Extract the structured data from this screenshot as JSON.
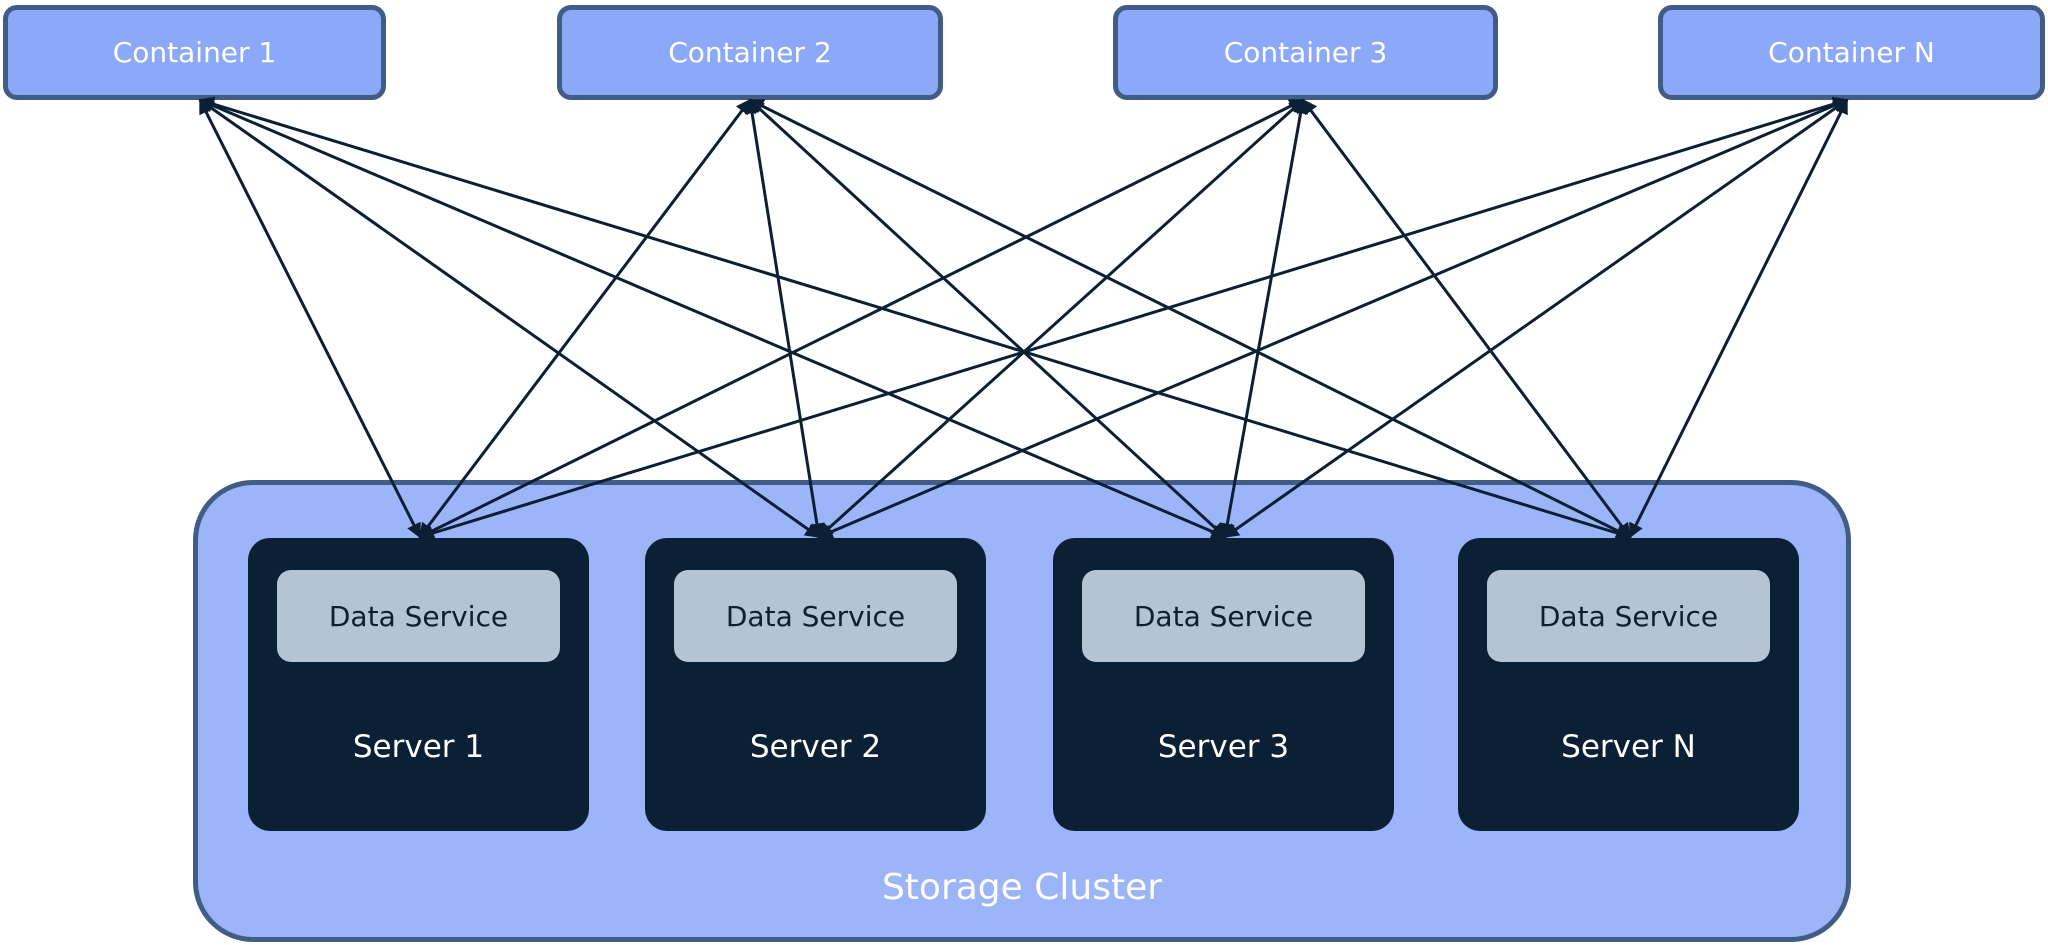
{
  "diagram": {
    "containers": [
      {
        "id": "c1",
        "label": "Container 1"
      },
      {
        "id": "c2",
        "label": "Container 2"
      },
      {
        "id": "c3",
        "label": "Container 3"
      },
      {
        "id": "cn",
        "label": "Container N"
      }
    ],
    "cluster": {
      "label": "Storage Cluster",
      "servers": [
        {
          "id": "s1",
          "label": "Server 1",
          "service": "Data Service"
        },
        {
          "id": "s2",
          "label": "Server 2",
          "service": "Data Service"
        },
        {
          "id": "s3",
          "label": "Server 3",
          "service": "Data Service"
        },
        {
          "id": "sn",
          "label": "Server N",
          "service": "Data Service"
        }
      ]
    },
    "edges": {
      "type": "bidirectional",
      "pattern": "every container connects to every server"
    },
    "colors": {
      "container_fill": "#8ca8f8",
      "container_border": "#415d86",
      "cluster_fill": "#9cb4f8",
      "server_fill": "#0b1f35",
      "service_fill": "#b4c4d4",
      "edge": "#0b1f35"
    }
  }
}
